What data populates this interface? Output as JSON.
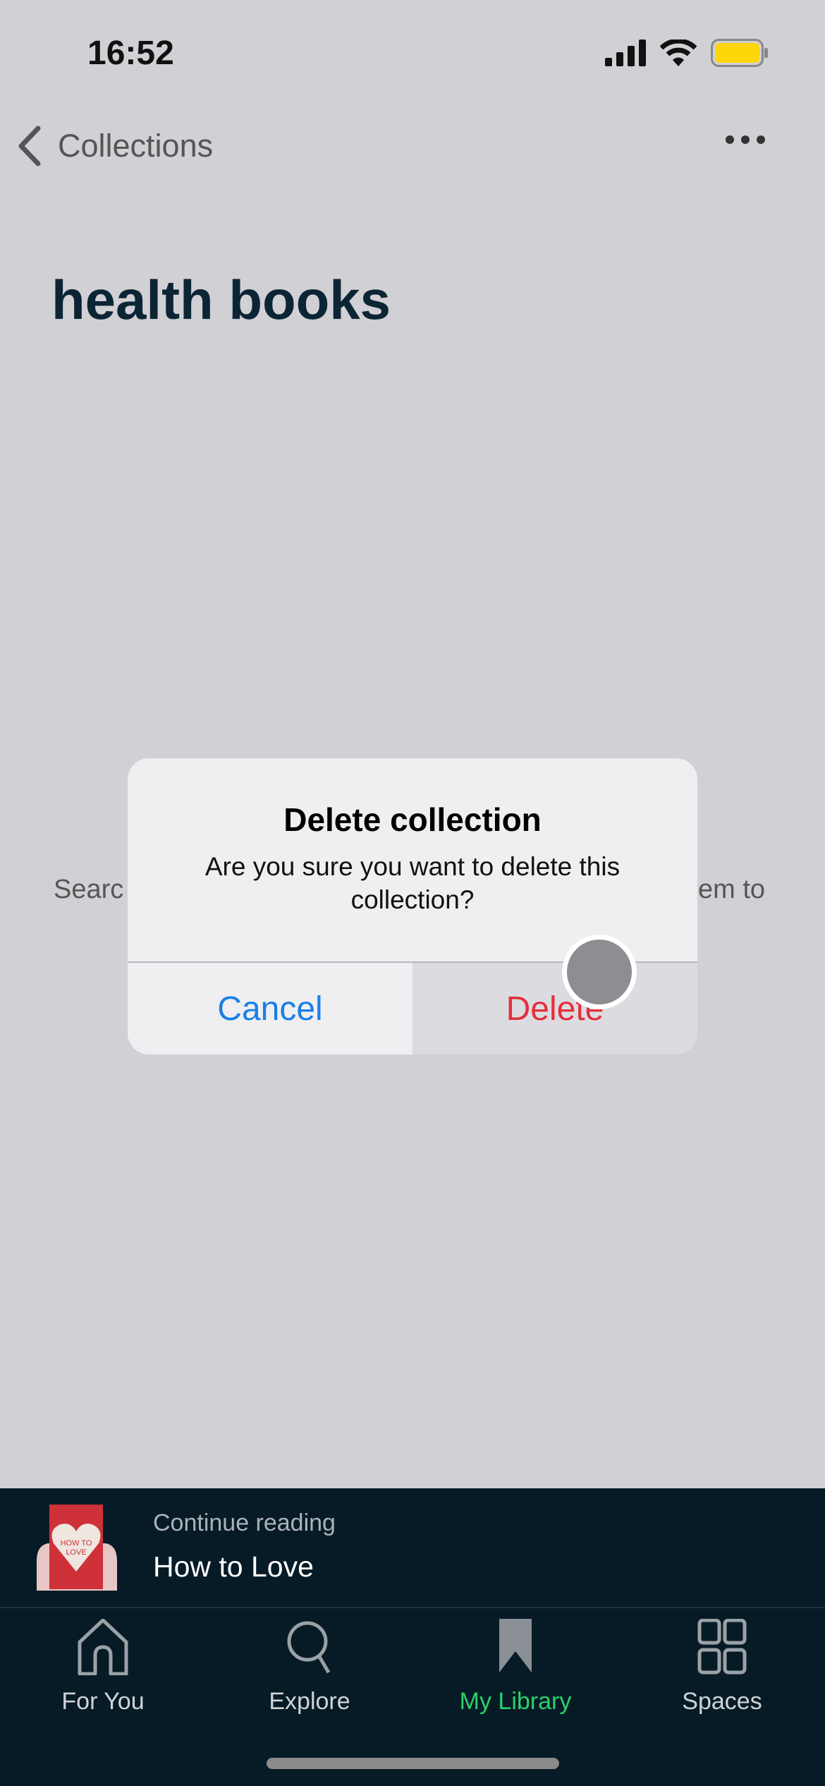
{
  "status_bar": {
    "time": "16:52",
    "battery_color": "#ffd60a"
  },
  "nav": {
    "back_label": "Collections",
    "more_icon": "ellipsis-icon"
  },
  "page": {
    "title": "health books",
    "empty_text_left": "Searc",
    "empty_text_right": "em to"
  },
  "dialog": {
    "title": "Delete collection",
    "message": "Are you sure you want to delete this collection?",
    "cancel_label": "Cancel",
    "delete_label": "Delete",
    "cancel_color": "#1a7fe6",
    "delete_color": "#e52f3d"
  },
  "continue_reading": {
    "label": "Continue reading",
    "book_title": "How to Love",
    "cover_text": "HOW TO LOVE"
  },
  "tabs": [
    {
      "label": "For You",
      "icon": "home-icon",
      "active": false
    },
    {
      "label": "Explore",
      "icon": "search-icon",
      "active": false
    },
    {
      "label": "My Library",
      "icon": "bookmark-icon",
      "active": true
    },
    {
      "label": "Spaces",
      "icon": "grid-icon",
      "active": false
    }
  ],
  "accent_color": "#2bcf6b"
}
